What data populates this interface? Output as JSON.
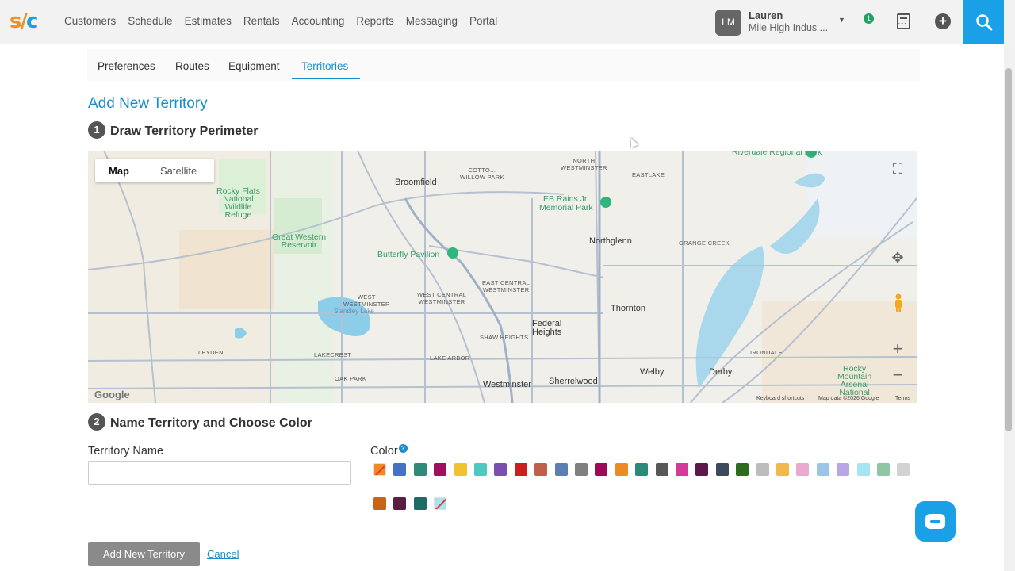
{
  "logo": {
    "s": "s",
    "slash": "/",
    "c": "c"
  },
  "nav": [
    "Customers",
    "Schedule",
    "Estimates",
    "Rentals",
    "Accounting",
    "Reports",
    "Messaging",
    "Portal"
  ],
  "user": {
    "initials": "LM",
    "name": "Lauren",
    "company": "Mile High Indus ...",
    "notification_count": "1"
  },
  "tabs": [
    {
      "label": "Preferences"
    },
    {
      "label": "Routes"
    },
    {
      "label": "Equipment"
    },
    {
      "label": "Territories",
      "active": true
    }
  ],
  "page_title": "Add New Territory",
  "step1": {
    "num": "1",
    "label": "Draw Territory Perimeter"
  },
  "map": {
    "toggle_map": "Map",
    "toggle_satellite": "Satellite",
    "labels": {
      "broomfield": "Broomfield",
      "rocky_flats": "Rocky Flats\nNational\nWildlife\nRefuge",
      "great_western": "Great Western\nReservoir",
      "butterfly": "Butterfly Pavilion",
      "eb_rains": "EB Rains Jr.\nMemorial Park",
      "northglenn": "Northglenn",
      "thornton": "Thornton",
      "federal_heights": "Federal\nHeights",
      "westminster": "Westminster",
      "sherrelwood": "Sherrelwood",
      "welby": "Welby",
      "derby": "Derby",
      "rocky_mountain": "Rocky\nMountain\nArsenal\nNational",
      "riverdale": "Riverdale Regional Park",
      "north_westminster": "NORTH\nWESTMINSTER",
      "eastlake": "EASTLAKE",
      "grange_creek": "GRANGE CREEK",
      "cottonwood": "COTTO...\nWILLOW PARK",
      "west_westminster": "WEST\nWESTMINSTER",
      "west_central": "WEST CENTRAL\nWESTMINSTER",
      "east_central": "EAST CENTRAL\nWESTMINSTER",
      "shaw_heights": "SHAW HEIGHTS",
      "lake_arbor": "LAKE ARBOR",
      "lakecrest": "LAKECREST",
      "oak_park": "OAK PARK",
      "leyden": "LEYDEN",
      "irondale": "IRONDALE",
      "standley": "Standley Lake"
    },
    "footer": {
      "shortcuts": "Keyboard shortcuts",
      "data": "Map data ©2026 Google",
      "terms": "Terms"
    },
    "google": "Google"
  },
  "step2": {
    "num": "2",
    "label": "Name Territory and Choose Color"
  },
  "territory_name": {
    "label": "Territory Name",
    "value": "",
    "placeholder": ""
  },
  "color": {
    "label": "Color",
    "help": "?",
    "swatches": [
      "none",
      "#4472c4",
      "#2e8b7a",
      "#a0105f",
      "#f2c12e",
      "#4ec9c0",
      "#7b4fb0",
      "#cc1f1f",
      "#c0604a",
      "#5b7fb5",
      "#808080",
      "#9c0a58",
      "#ef8a23",
      "#2a8a7a",
      "#585858",
      "#d43a9a",
      "#5c1848",
      "#3d4a5c",
      "#2f6b1e",
      "#bdbdbd",
      "#f1b84a",
      "#eaa9cf",
      "#9ac7e8",
      "#b9a7e5",
      "#a6e4f2",
      "#8fc7a5",
      "#d2d2d2",
      "#c8641a",
      "#5a1e44",
      "#1e6b66",
      "none"
    ]
  },
  "buttons": {
    "add": "Add New Territory",
    "cancel": "Cancel"
  }
}
